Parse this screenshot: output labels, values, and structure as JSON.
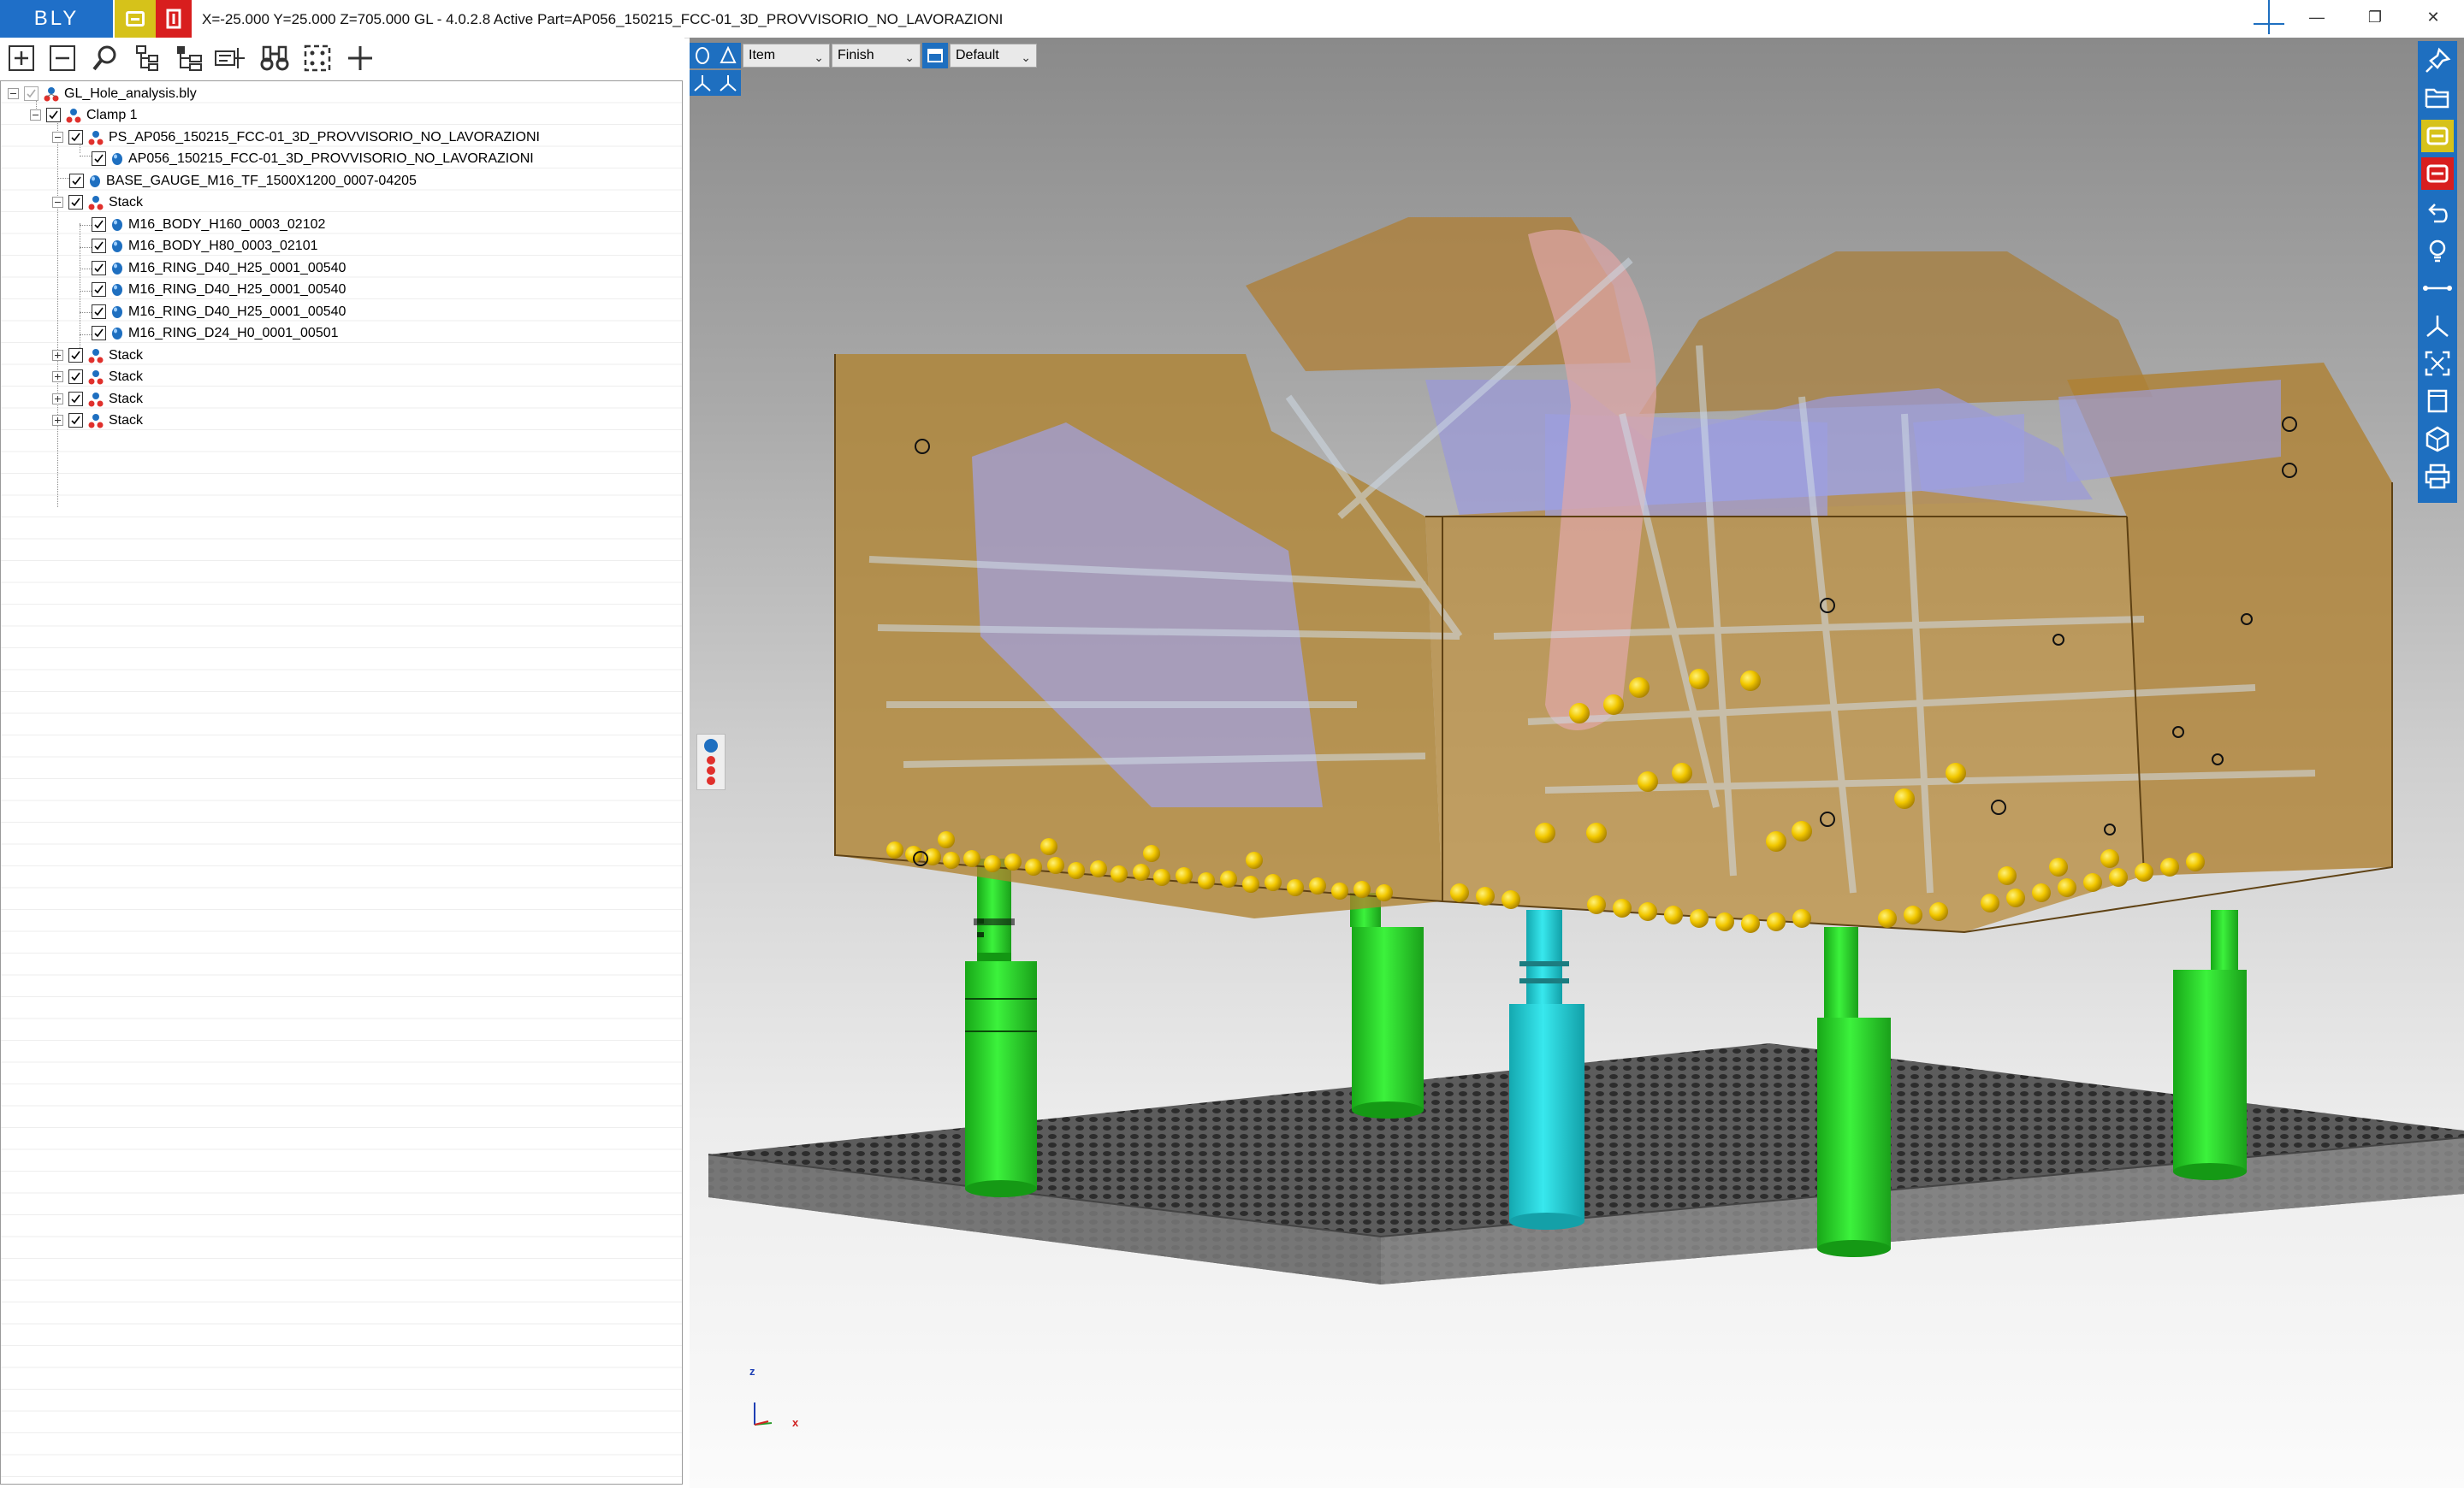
{
  "titlebar": {
    "logo": "BLY",
    "coordinates": "X=-25.000 Y=25.000 Z=705.000",
    "title": "GL - 4.0.2.8 Active Part=AP056_150215_FCC-01_3D_PROVVISORIO_NO_LAVORAZIONI",
    "window_controls": [
      "minimize-icon",
      "restore-icon",
      "close-icon"
    ]
  },
  "left_toolbar": {
    "tools": [
      "expand-all-icon",
      "collapse-all-icon",
      "search-icon",
      "tree-structure-icon",
      "hierarchy-icon",
      "properties-icon",
      "binoculars-icon",
      "fit-selection-icon",
      "add-icon"
    ]
  },
  "tree": {
    "nodes": [
      {
        "label": "GL_Hole_analysis.bly",
        "level": 0,
        "icon": "assembly-icon"
      },
      {
        "label": "Clamp 1",
        "level": 1,
        "icon": "clamp-icon"
      },
      {
        "label": "PS_AP056_150215_FCC-01_3D_PROVVISORIO_NO_LAVORAZIONI",
        "level": 2,
        "icon": "part-set-icon"
      },
      {
        "label": "AP056_150215_FCC-01_3D_PROVVISORIO_NO_LAVORAZIONI",
        "level": 3,
        "icon": "part-icon"
      },
      {
        "label": "BASE_GAUGE_M16_TF_1500X1200_0007-04205",
        "level": 2,
        "icon": "part-icon"
      },
      {
        "label": "Stack",
        "level": 2,
        "icon": "stack-icon"
      },
      {
        "label": "M16_BODY_H160_0003_02102",
        "level": 3,
        "icon": "part-icon"
      },
      {
        "label": "M16_BODY_H80_0003_02101",
        "level": 3,
        "icon": "part-icon"
      },
      {
        "label": "M16_RING_D40_H25_0001_00540",
        "level": 3,
        "icon": "part-icon"
      },
      {
        "label": "M16_RING_D40_H25_0001_00540",
        "level": 3,
        "icon": "part-icon"
      },
      {
        "label": "M16_RING_D40_H25_0001_00540",
        "level": 3,
        "icon": "part-icon"
      },
      {
        "label": "M16_RING_D24_H0_0001_00501",
        "level": 3,
        "icon": "part-icon"
      },
      {
        "label": "Stack",
        "level": 2,
        "icon": "stack-icon"
      },
      {
        "label": "Stack",
        "level": 2,
        "icon": "stack-icon"
      },
      {
        "label": "Stack",
        "level": 2,
        "icon": "stack-icon"
      },
      {
        "label": "Stack",
        "level": 2,
        "icon": "stack-icon"
      }
    ]
  },
  "viewport_toolbar": {
    "filter_value": "Item",
    "mode_value": "Finish",
    "style_value": "Default"
  },
  "axes": {
    "z": "z",
    "x": "x"
  },
  "colors": {
    "accent": "#1e6fc0",
    "support_green": "#2fe02f",
    "support_cyan": "#22d8d8",
    "part_body": "#c8903a",
    "hole_balls": "#f0c800"
  },
  "right_toolbar": {
    "tools": [
      "pin-icon",
      "open-folder-icon",
      "yellow-module-icon",
      "red-module-icon",
      "undo-icon",
      "light-bulb-icon",
      "measure-icon",
      "axis-icon",
      "fit-view-icon",
      "view-front-icon",
      "view-iso-icon",
      "print-icon"
    ]
  }
}
